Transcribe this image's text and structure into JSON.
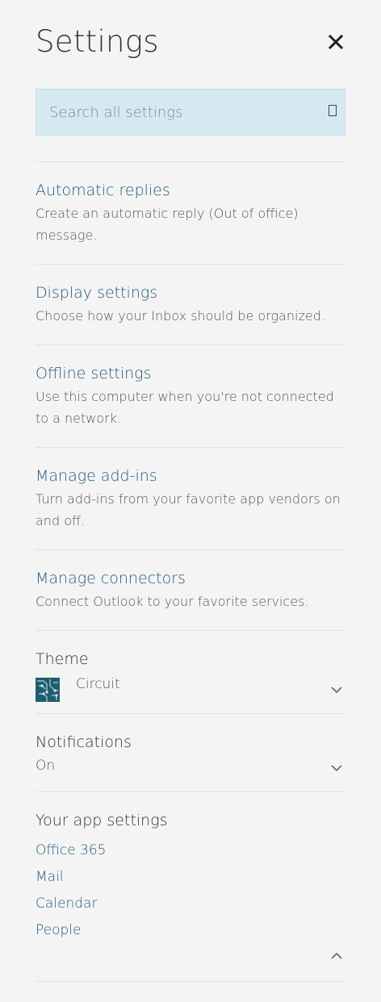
{
  "header": {
    "title": "Settings",
    "close_icon": "close-icon"
  },
  "search": {
    "placeholder": "Search all settings",
    "value": "",
    "icon": "search-icon"
  },
  "items": [
    {
      "title": "Automatic replies",
      "description": "Create an automatic reply (Out of office) message."
    },
    {
      "title": "Display settings",
      "description": "Choose how your Inbox should be organized."
    },
    {
      "title": "Offline settings",
      "description": "Use this computer when you're not connected to a network."
    },
    {
      "title": "Manage add-ins",
      "description": "Turn add-ins from your favorite app vendors on and off."
    },
    {
      "title": "Manage connectors",
      "description": "Connect Outlook to your favorite services."
    }
  ],
  "theme": {
    "label": "Theme",
    "value": "Circuit",
    "expand_icon": "chevron-down-icon"
  },
  "notifications": {
    "label": "Notifications",
    "value": "On",
    "expand_icon": "chevron-down-icon"
  },
  "app_settings": {
    "label": "Your app settings",
    "links": [
      "Office 365",
      "Mail",
      "Calendar",
      "People"
    ],
    "collapse_icon": "chevron-up-icon"
  },
  "colors": {
    "background": "#f4f4f4",
    "search_bg": "#d5eaf0",
    "link": "#1e5a7a",
    "theme_thumb": "#1f5d6e"
  }
}
